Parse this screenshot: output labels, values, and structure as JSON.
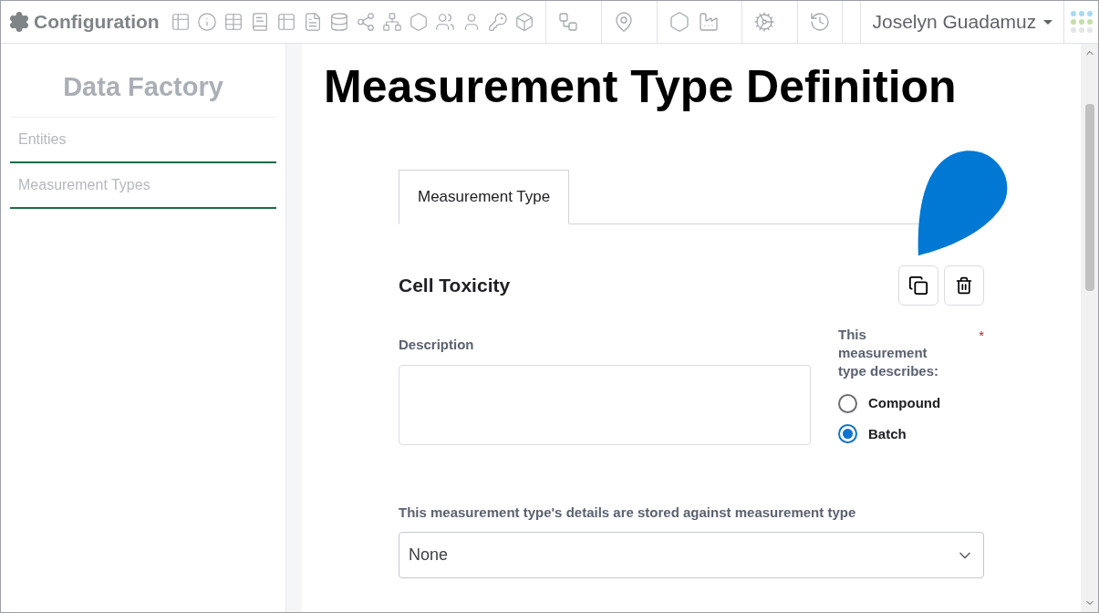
{
  "app": {
    "title": "Configuration"
  },
  "user": {
    "name": "Joselyn Guadamuz"
  },
  "sidebar": {
    "title": "Data Factory",
    "items": [
      {
        "label": "Entities"
      },
      {
        "label": "Measurement Types"
      }
    ]
  },
  "page": {
    "title": "Measurement Type Definition"
  },
  "tabs": [
    {
      "label": "Measurement Type",
      "selected": true
    }
  ],
  "record": {
    "name": "Cell Toxicity"
  },
  "description": {
    "label": "Description"
  },
  "describes": {
    "label": "This measurement type describes:",
    "required_mark": "*",
    "options": [
      {
        "label": "Compound",
        "selected": false
      },
      {
        "label": "Batch",
        "selected": true
      }
    ]
  },
  "stored_against": {
    "label": "This measurement type's details are stored against measurement type",
    "value": "None"
  }
}
